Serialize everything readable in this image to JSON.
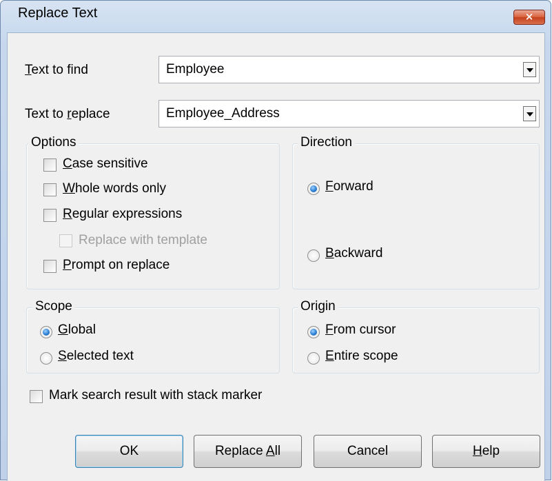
{
  "dialog": {
    "title": "Replace Text",
    "close_glyph": "×"
  },
  "text_to_find": {
    "label_accel": "T",
    "label_rest": "ext to find",
    "value": "Employee"
  },
  "text_to_replace": {
    "label_pre": "Text to ",
    "label_accel": "r",
    "label_rest": "eplace",
    "value": "Employee_Address"
  },
  "options": {
    "title": "Options",
    "case_sensitive": {
      "accel": "C",
      "rest": "ase sensitive",
      "checked": false
    },
    "whole_words": {
      "accel": "W",
      "rest": "hole words only",
      "checked": false
    },
    "regular_expressions": {
      "accel": "R",
      "rest": "egular expressions",
      "checked": false
    },
    "replace_with_template": {
      "label": "Replace with template",
      "checked": false,
      "enabled": false
    },
    "prompt_on_replace": {
      "accel": "P",
      "rest": "rompt on replace",
      "checked": false
    }
  },
  "direction": {
    "title": "Direction",
    "forward": {
      "accel": "F",
      "rest": "orward",
      "selected": true
    },
    "backward": {
      "accel": "B",
      "rest": "ackward",
      "selected": false
    }
  },
  "scope": {
    "title": "Scope",
    "global": {
      "accel": "G",
      "rest": "lobal",
      "selected": true
    },
    "selected_text": {
      "accel": "S",
      "rest": "elected text",
      "selected": false
    }
  },
  "origin": {
    "title": "Origin",
    "from_cursor": {
      "accel": "F",
      "rest": "rom cursor",
      "selected": true
    },
    "entire_scope": {
      "accel": "E",
      "rest": "ntire scope",
      "selected": false
    }
  },
  "mark_stack_marker": {
    "label": "Mark search result with stack marker",
    "checked": false
  },
  "buttons": {
    "ok": "OK",
    "replace_all_pre": "Replace ",
    "replace_all_accel": "A",
    "replace_all_rest": "ll",
    "cancel": "Cancel",
    "help_accel": "H",
    "help_rest": "elp"
  },
  "colors": {
    "title_bar": "#c7d8ee",
    "client_bg": "#f0f0f0",
    "close_button": "#c6401c",
    "radio_selected": "#2b7fd3"
  }
}
